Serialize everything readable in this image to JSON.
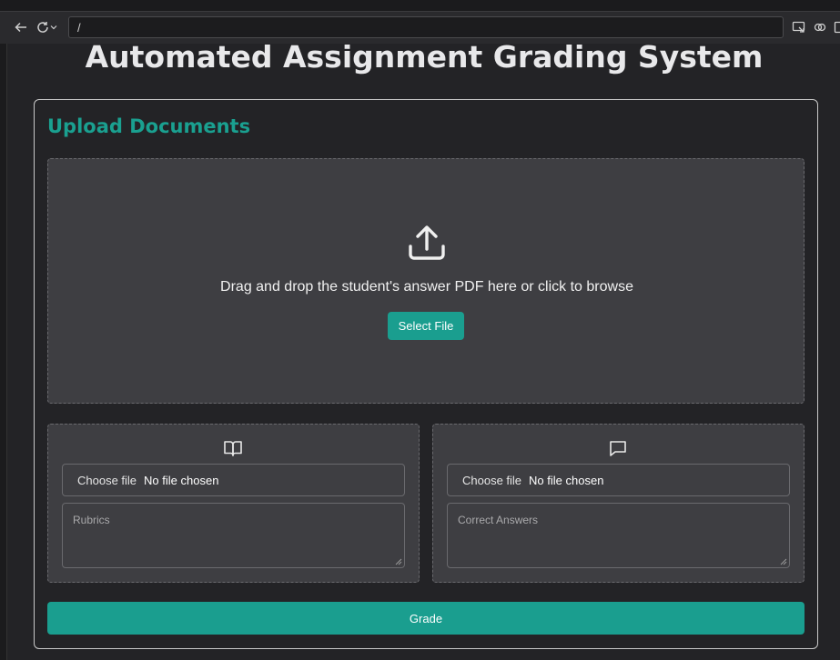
{
  "browser": {
    "url": "/",
    "icons": [
      "back-icon",
      "reload-icon",
      "cast-icon",
      "link-icon",
      "sidebar-icon"
    ]
  },
  "page": {
    "title": "Automated Assignment Grading System"
  },
  "upload": {
    "heading": "Upload Documents",
    "drop_text": "Drag and drop the student's answer PDF here or click to browse",
    "select_label": "Select File",
    "icon": "upload-icon"
  },
  "rubrics_panel": {
    "icon": "book-icon",
    "choose_label": "Choose file",
    "file_status": "No file chosen",
    "placeholder": "Rubrics"
  },
  "answers_panel": {
    "icon": "message-icon",
    "choose_label": "Choose file",
    "file_status": "No file chosen",
    "placeholder": "Correct Answers"
  },
  "actions": {
    "grade_label": "Grade"
  },
  "colors": {
    "accent": "#1a9e8f",
    "background": "#232326",
    "panel": "#3e3e42"
  }
}
